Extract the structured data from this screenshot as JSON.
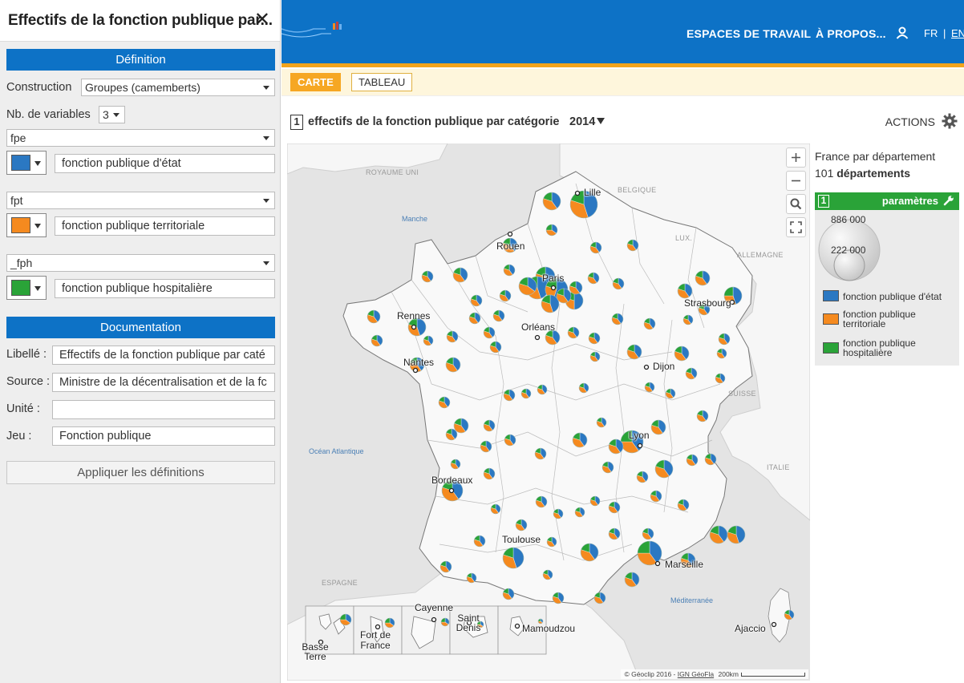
{
  "panel": {
    "title": "Effectifs de la fonction publique par...",
    "close_glyph": "✕"
  },
  "definition": {
    "header": "Définition",
    "construction_label": "Construction",
    "construction_value": "Groupes (camemberts)",
    "nb_vars_label": "Nb. de variables",
    "nb_vars_value": "3",
    "variables": [
      {
        "code": "fpe",
        "color": "#2b78c2",
        "label": "fonction publique d'état"
      },
      {
        "code": "fpt",
        "color": "#f58a1f",
        "label": "fonction publique territoriale"
      },
      {
        "code": "_fph",
        "color": "#2aa338",
        "label": "fonction publique hospitalière"
      }
    ]
  },
  "documentation": {
    "header": "Documentation",
    "libelle_label": "Libellé :",
    "libelle_value": "Effectifs de la fonction publique par caté",
    "source_label": "Source :",
    "source_value": "Ministre de la décentralisation et de la fc",
    "unite_label": "Unité :",
    "unite_value": "",
    "jeu_label": "Jeu :",
    "jeu_value": "Fonction publique"
  },
  "apply_label": "Appliquer les définitions",
  "header": {
    "nav": [
      "ESPACES DE TRAVAIL",
      "À PROPOS..."
    ],
    "lang_fr": "FR",
    "lang_sep": "|",
    "lang_en": "EN"
  },
  "tabs": [
    "CARTE",
    "TABLEAU"
  ],
  "map_title": {
    "number": "1",
    "title": "effectifs de la fonction publique par catégorie",
    "year": "2014",
    "actions": "ACTIONS"
  },
  "map": {
    "cities": [
      "Lille",
      "Rouen",
      "Paris",
      "Strasbourg",
      "Rennes",
      "Orléans",
      "Nantes",
      "Dijon",
      "Lyon",
      "Bordeaux",
      "Toulouse",
      "Marseille",
      "Ajaccio",
      "Basse Terre",
      "Fort de France",
      "Cayenne",
      "Saint Denis",
      "Mamoudzou"
    ],
    "countries": [
      "ROYAUME UNI",
      "BELGIQUE",
      "LUX.",
      "ALLEMAGNE",
      "SUISSE",
      "ITALIE",
      "ESPAGNE"
    ],
    "seas": [
      "Manche",
      "Océan Atlantique",
      "Méditerranée"
    ],
    "credits": {
      "geoclip": "© Géoclip 2016 -",
      "ign": "IGN GéoFla",
      "scale": "200km"
    }
  },
  "legend": {
    "scope": "France par département",
    "count": "101",
    "count_unit": "départements",
    "panel_number": "1",
    "panel_label": "paramètres",
    "size_large": "886 000",
    "size_small": "222 000",
    "items": [
      {
        "label": "fonction publique d'état",
        "color": "#2b78c2"
      },
      {
        "label": "fonction publique territoriale",
        "color": "#f58a1f"
      },
      {
        "label": "fonction publique hospitalière",
        "color": "#2aa338"
      }
    ]
  }
}
